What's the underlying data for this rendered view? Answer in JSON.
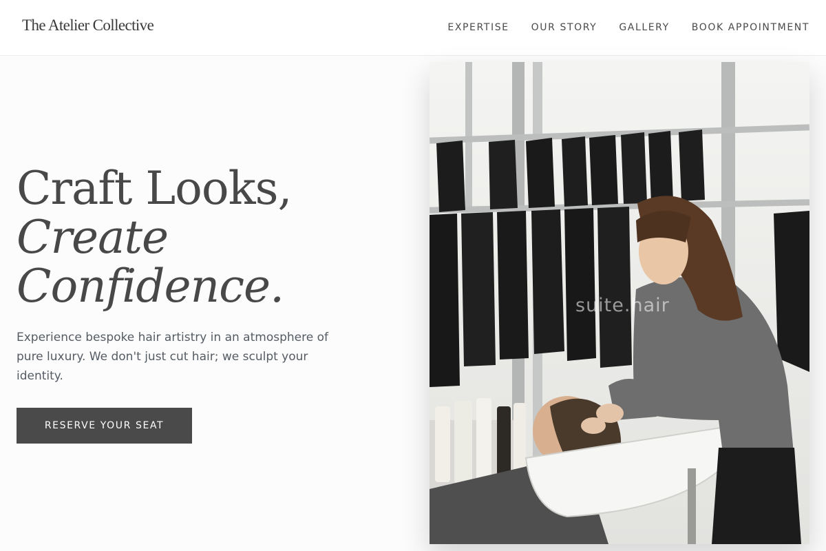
{
  "brand": {
    "name": "The Atelier Collective"
  },
  "nav": {
    "items": [
      {
        "label": "EXPERTISE"
      },
      {
        "label": "OUR STORY"
      },
      {
        "label": "GALLERY"
      },
      {
        "label": "BOOK APPOINTMENT"
      }
    ]
  },
  "hero": {
    "title_line1": "Craft Looks,",
    "title_line2": "Create",
    "title_line3": "Confidence.",
    "subtitle": "Experience bespoke hair artistry in an atmosphere of pure luxury. We don't just cut hair; we sculpt your identity.",
    "cta_label": "RESERVE YOUR SEAT"
  },
  "photo": {
    "watermark": "suite.hair"
  },
  "colors": {
    "text": "#484848",
    "button_bg": "#4a4a4a",
    "page_bg": "#fcfcfc"
  }
}
